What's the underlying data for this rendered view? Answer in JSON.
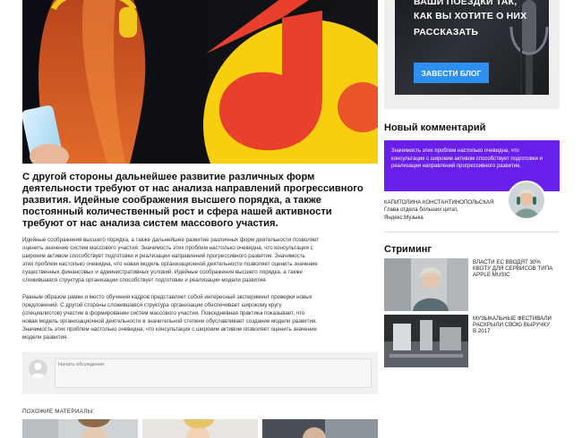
{
  "article": {
    "lead": "С другой стороны дальнейшее развитие различных форм деятельности требуют от нас анализа направлений прогрессивного развития. Идейные соображения высшего порядка, а также постоянный количественный рост и сфера нашей активности требуют от нас анализа систем массового участия.",
    "paragraph_1_lines": [
      "Идейные соображения высшего порядка, а также дальнейшее развитие различных форм деятельности позволяет",
      "оценить значение систем массового участия. Значимость этих проблем настолько очевидна, что консультация с",
      "широким активом способствует подготовки и реализации направлений прогрессивного развития. Значимость",
      "этих проблем настолько очевидна, что новая модель организационной деятельности позволяет оценить значение",
      "существенных финансовых и административных условий. Идейные соображения высшего порядка, а также",
      "сложившаяся структура организации способствует подготовки и реализации модели развития."
    ],
    "paragraph_2_lines": [
      "Равным образом рамки и место обучения кадров представляет собой интересный эксперимент проверки новых",
      "предложений. С другой стороны сложившаяся структура организации обеспечивает широкому кругу",
      "(специалистов) участие в формировании систем массового участия. Повседневная практика показывает, что",
      "новая модель организационной деятельности в значительной степени обуславливает создание модели развития.",
      "Значимость этих проблем настолько очевидна, что консультация с широким активом позволяет оценить значение",
      "модели развития."
    ]
  },
  "comments": {
    "input_placeholder": "Начать обсуждение"
  },
  "related": {
    "title": "ПОХОЖИЕ МАТЕРИАЛЫ:"
  },
  "sidebar": {
    "banner": {
      "line_1": "ВАШИ ПОЕЗДКИ ТАК,",
      "line_2": "КАК ВЫ ХОТИТЕ О НИХ",
      "line_3": "РАССКАЗАТЬ",
      "button": "ЗАВЕСТИ БЛОГ"
    },
    "new_comment": {
      "title": "Новый комментарий",
      "quote": "Значимость этих проблем настолько очевидна, что консультация с широким активом способствует подготовки и реализации направлений прогрессивного развития.",
      "author_name": "Капитолина Константинопольская",
      "author_role_1": "Глава отдела больших цитат,",
      "author_role_2": "Яндекс.Музыка"
    },
    "streaming": {
      "title": "Стриминг",
      "items": [
        {
          "title": "ВЛАСТИ ЕС ВВОДЯТ 30% КВОТУ ДЛЯ СЕРВИСОВ ТИПА APPLE MUSIC"
        },
        {
          "title": "МУЗЫКАЛЬНЫЕ ФЕСТИВАЛИ РАСКРЫЛИ СВОЮ ВЫРУЧКУ В 2017"
        }
      ]
    }
  },
  "colors": {
    "accent_purple": "#6a1eea",
    "button_blue": "#2d8ff0",
    "hero_yellow": "#f7cf0f",
    "hero_red": "#e8402c"
  }
}
